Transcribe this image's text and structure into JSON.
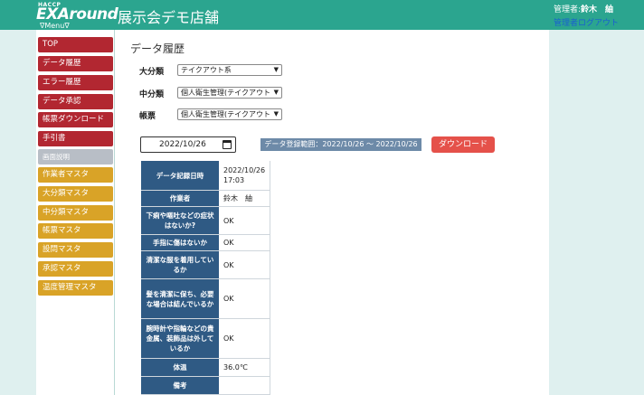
{
  "header": {
    "logo_top": "HACCP",
    "logo_brand": "EXAround",
    "menu_label": "∇Menu∇",
    "store_name": "展示会デモ店舗",
    "user_prefix": "管理者:",
    "user_name": "鈴木　紬",
    "logout_label": "管理者ログアウト",
    "color": "#2ba58f"
  },
  "sidebar": {
    "items": [
      {
        "label": "TOP",
        "color": "red"
      },
      {
        "label": "データ履歴",
        "color": "red"
      },
      {
        "label": "エラー履歴",
        "color": "red"
      },
      {
        "label": "データ承認",
        "color": "red"
      },
      {
        "label": "帳票ダウンロード",
        "color": "red"
      },
      {
        "label": "手引書",
        "color": "red"
      },
      {
        "label": "画面説明",
        "color": "gray"
      },
      {
        "label": "作業者マスタ",
        "color": "yellow"
      },
      {
        "label": "大分類マスタ",
        "color": "yellow"
      },
      {
        "label": "中分類マスタ",
        "color": "yellow"
      },
      {
        "label": "帳票マスタ",
        "color": "yellow"
      },
      {
        "label": "設問マスタ",
        "color": "yellow"
      },
      {
        "label": "承認マスタ",
        "color": "yellow"
      },
      {
        "label": "温度管理マスタ",
        "color": "yellow"
      }
    ]
  },
  "main": {
    "title": "データ履歴",
    "filters": {
      "major_label": "大分類",
      "major_value": "テイクアウト系",
      "middle_label": "中分類",
      "middle_value": "個人衛生管理(テイクアウト",
      "form_label": "帳票",
      "form_value": "個人衛生管理(テイクアウト"
    },
    "date_value": "2022/10/26",
    "range_text": "データ登録範囲：2022/10/26 〜 2022/10/26",
    "download_label": "ダウンロード",
    "table": [
      {
        "label": "データ記録日時",
        "value": "2022/10/26 17:03"
      },
      {
        "label": "作業者",
        "value": "鈴木　紬"
      },
      {
        "label": "下痢や嘔吐などの症状はないか?",
        "value": "OK"
      },
      {
        "label": "手指に傷はないか",
        "value": "OK"
      },
      {
        "label": "清潔な服を着用しているか",
        "value": "OK"
      },
      {
        "label": "髪を清潔に保ち、必要な場合は結んでいるか",
        "value": "OK"
      },
      {
        "label": "腕時計や指輪などの貴金属、装飾品は外しているか",
        "value": "OK"
      },
      {
        "label": "体温",
        "value": "36.0℃"
      },
      {
        "label": "備考",
        "value": ""
      }
    ]
  },
  "colors": {
    "nav_red": "#b22731",
    "nav_gray": "#b8bec6",
    "nav_yellow": "#d9a327",
    "table_header": "#2f5a84",
    "download": "#e5514a",
    "range_bar": "#6d8aa8"
  }
}
